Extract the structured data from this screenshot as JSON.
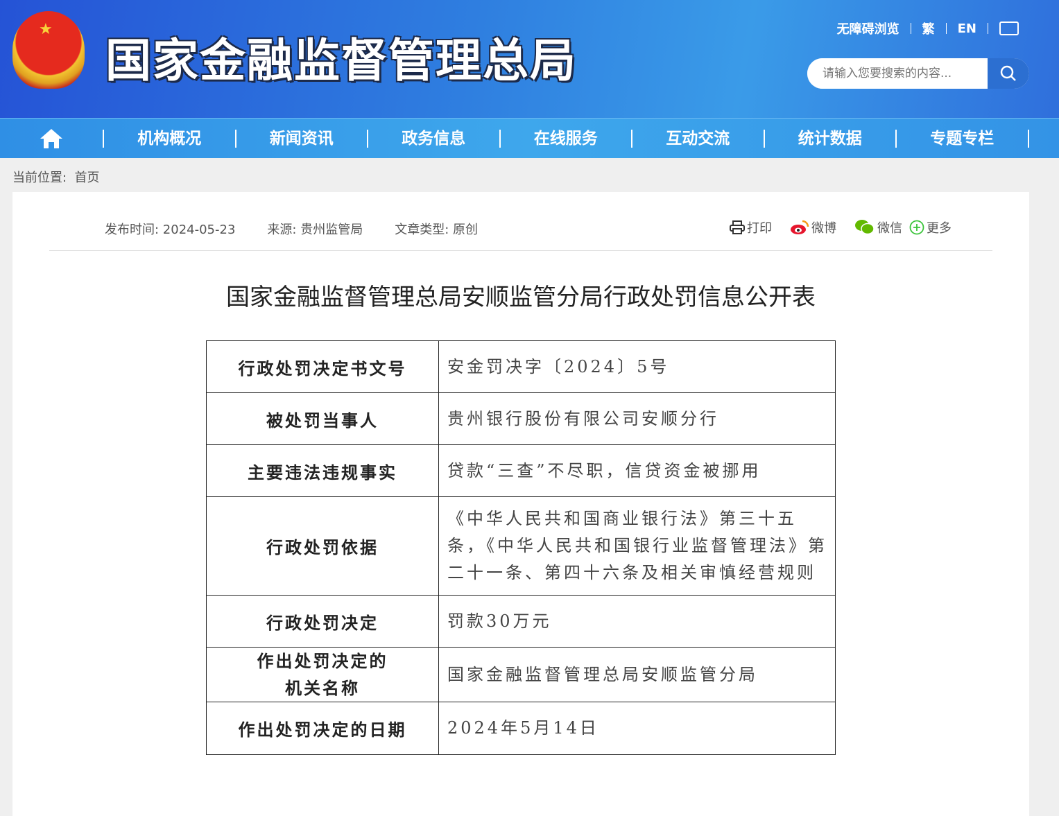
{
  "header": {
    "site_title": "国家金融监督管理总局",
    "toplinks": [
      "无障碍浏览",
      "繁",
      "EN"
    ],
    "search_placeholder": "请输入您要搜索的内容..."
  },
  "nav": [
    "机构概况",
    "新闻资讯",
    "政务信息",
    "在线服务",
    "互动交流",
    "统计数据",
    "专题专栏"
  ],
  "breadcrumb": {
    "label": "当前位置:",
    "current": "首页"
  },
  "meta": {
    "date": "发布时间: 2024-05-23",
    "source": "来源: 贵州监管局",
    "type": "文章类型: 原创"
  },
  "share": {
    "print": "打印",
    "weibo": "微博",
    "wechat": "微信",
    "more": "更多"
  },
  "article": {
    "title": "国家金融监督管理总局安顺监管分局行政处罚信息公开表",
    "rows": [
      {
        "k": "行政处罚决定书文号",
        "v": "安金罚决字〔2024〕5号"
      },
      {
        "k": "被处罚当事人",
        "v": "贵州银行股份有限公司安顺分行"
      },
      {
        "k": "主要违法违规事实",
        "v": "贷款“三查”不尽职，信贷资金被挪用"
      },
      {
        "k": "行政处罚依据",
        "v": "《中华人民共和国商业银行法》第三十五条，《中华人民共和国银行业监督管理法》第二十一条、第四十六条及相关审慎经营规则"
      },
      {
        "k": "行政处罚决定",
        "v": "罚款30万元"
      },
      {
        "k": "作出处罚决定的机关名称",
        "v": "国家金融监督管理总局安顺监管分局"
      },
      {
        "k": "作出处罚决定的日期",
        "v": "2024年5月14日"
      }
    ]
  }
}
